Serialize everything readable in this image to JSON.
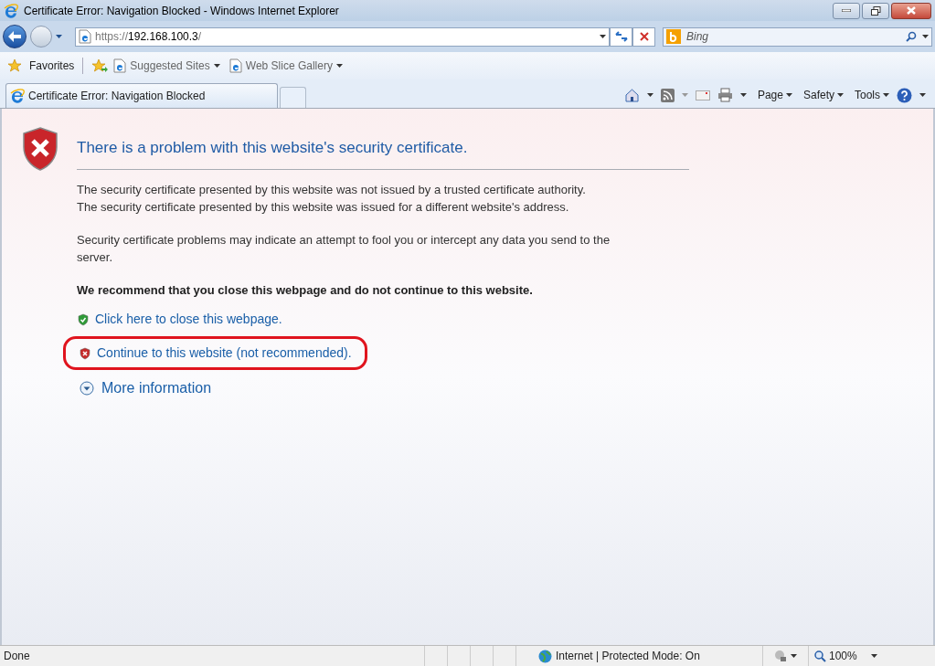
{
  "window": {
    "title": "Certificate Error: Navigation Blocked - Windows Internet Explorer"
  },
  "address_bar": {
    "scheme": "https://",
    "host": "192.168.100.3",
    "path": "/"
  },
  "search": {
    "placeholder": "Bing"
  },
  "favorites_bar": {
    "label": "Favorites",
    "items": [
      {
        "label": "Suggested Sites"
      },
      {
        "label": "Web Slice Gallery"
      }
    ]
  },
  "tabs": [
    {
      "label": "Certificate Error: Navigation Blocked",
      "selected": true
    }
  ],
  "command_bar": [
    "Page",
    "Safety",
    "Tools"
  ],
  "content": {
    "heading": "There is a problem with this website's security certificate.",
    "paragraphs": [
      [
        "The security certificate presented by this website was not issued by a trusted certificate authority.",
        "The security certificate presented by this website was issued for a different website's address."
      ],
      [
        "Security certificate problems may indicate an attempt to fool you or intercept any data you send to the server."
      ]
    ],
    "recommendation": "We recommend that you close this webpage and do not continue to this website.",
    "links": [
      {
        "kind": "safe",
        "label": "Click here to close this webpage.",
        "highlighted": false
      },
      {
        "kind": "unsafe",
        "label": "Continue to this website (not recommended).",
        "highlighted": true
      },
      {
        "kind": "expand",
        "label": "More information",
        "highlighted": false
      }
    ]
  },
  "status_bar": {
    "text": "Done",
    "zone": "Internet | Protected Mode: On",
    "zoom": "100%"
  }
}
